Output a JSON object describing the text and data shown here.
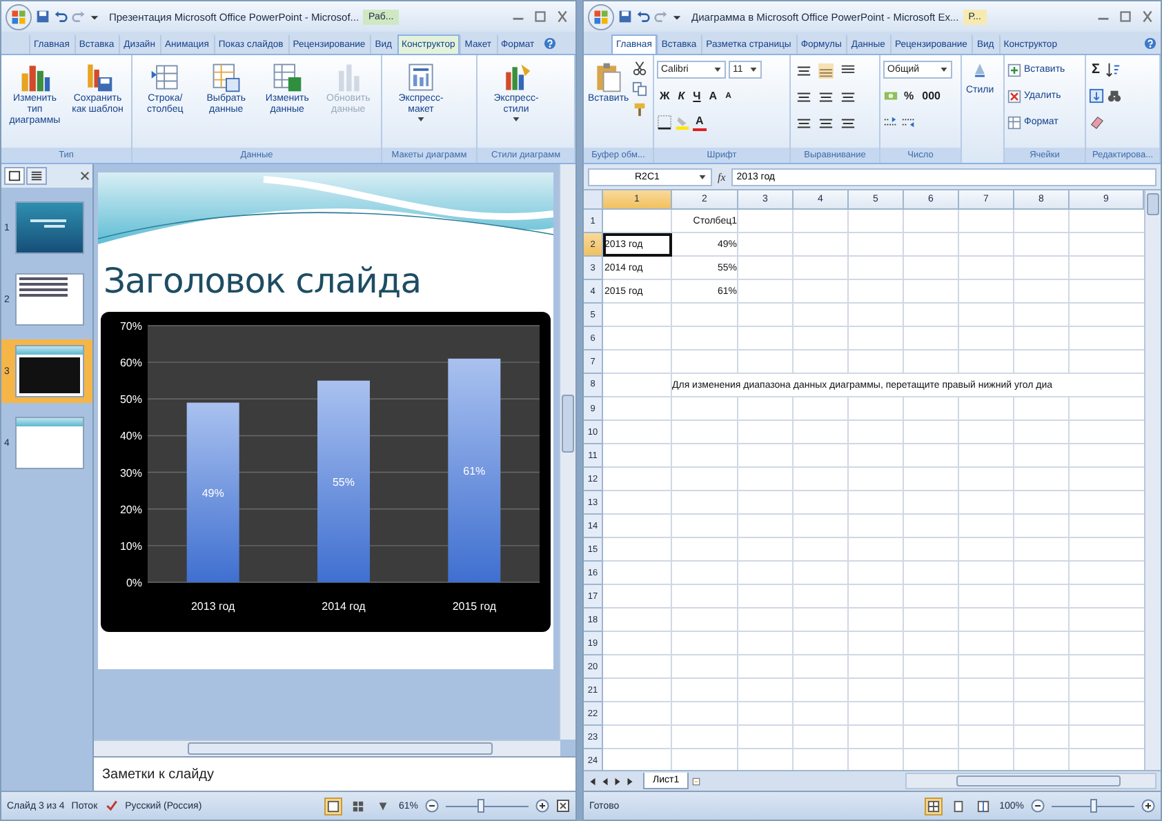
{
  "powerpoint": {
    "title": "Презентация Microsoft Office PowerPoint - Microsof...",
    "context_tab": "Раб...",
    "tabs": [
      {
        "label": "Главная",
        "selected": false
      },
      {
        "label": "Вставка",
        "selected": false
      },
      {
        "label": "Дизайн",
        "selected": false
      },
      {
        "label": "Анимация",
        "selected": false
      },
      {
        "label": "Показ слайдов",
        "selected": false
      },
      {
        "label": "Рецензирование",
        "selected": false
      },
      {
        "label": "Вид",
        "selected": false
      },
      {
        "label": "Конструктор",
        "selected": true
      },
      {
        "label": "Макет",
        "selected": false
      },
      {
        "label": "Формат",
        "selected": false
      }
    ],
    "ribbon": [
      {
        "label": "Тип",
        "buttons": [
          {
            "kind": "chart-type",
            "label": "Изменить тип диаграммы",
            "disabled": false
          },
          {
            "kind": "save-template",
            "label": "Сохранить как шаблон",
            "disabled": false
          }
        ]
      },
      {
        "label": "Данные",
        "buttons": [
          {
            "kind": "switch",
            "label": "Строка/столбец",
            "disabled": false
          },
          {
            "kind": "select-data",
            "label": "Выбрать данные",
            "disabled": false
          },
          {
            "kind": "edit-data",
            "label": "Изменить данные",
            "disabled": false
          },
          {
            "kind": "refresh",
            "label": "Обновить данные",
            "disabled": true
          }
        ]
      },
      {
        "label": "Макеты диаграмм",
        "buttons": [
          {
            "kind": "layout",
            "label": "Экспресс-макет",
            "disabled": false
          }
        ]
      },
      {
        "label": "Стили диаграмм",
        "buttons": [
          {
            "kind": "styles",
            "label": "Экспресс-стили",
            "disabled": false
          }
        ]
      }
    ],
    "pane_tabs": [
      {
        "kind": "slides",
        "selected": true
      },
      {
        "kind": "outline",
        "selected": false
      }
    ],
    "slides": [
      {
        "number": "1",
        "kind": "title",
        "selected": false
      },
      {
        "number": "2",
        "kind": "bullets",
        "selected": false
      },
      {
        "number": "3",
        "kind": "chart",
        "selected": true
      },
      {
        "number": "4",
        "kind": "blank",
        "selected": false
      }
    ],
    "slide": {
      "title": "Заголовок слайда",
      "chart_data": {
        "type": "bar",
        "categories": [
          "2013 год",
          "2014 год",
          "2015 год"
        ],
        "series": [
          {
            "color": "#3f6fd0",
            "values": [
              0.49,
              0.55,
              0.61
            ]
          }
        ],
        "ylim": [
          0,
          0.7
        ],
        "grid": true,
        "yticks": [
          {
            "value": 0,
            "label": "0%"
          },
          {
            "value": 0.1,
            "label": "10%"
          },
          {
            "value": 0.2,
            "label": "20%"
          },
          {
            "value": 0.3,
            "label": "30%"
          },
          {
            "value": 0.4,
            "label": "40%"
          },
          {
            "value": 0.5,
            "label": "50%"
          },
          {
            "value": 0.6,
            "label": "60%"
          },
          {
            "value": 0.7,
            "label": "70%"
          }
        ],
        "value_labels": [
          "49%",
          "55%",
          "61%"
        ]
      }
    },
    "notes": {
      "text": "Заметки к слайду"
    },
    "status": {
      "slide": "Слайд 3 из 4",
      "theme": "Поток",
      "language": "Русский (Россия)",
      "views": [
        {
          "kind": "normal",
          "selected": true
        },
        {
          "kind": "sorter",
          "selected": false
        },
        {
          "kind": "show",
          "selected": false
        }
      ],
      "zoom": "61%",
      "zoom_slider": {
        "level": 0.42
      }
    }
  },
  "excel": {
    "title": "Диаграмма в Microsoft Office PowerPoint - Microsoft Ex...",
    "context_tab": "Р...",
    "tabs": [
      {
        "label": "Главная",
        "selected": true
      },
      {
        "label": "Вставка",
        "selected": false
      },
      {
        "label": "Разметка страницы",
        "selected": false
      },
      {
        "label": "Формулы",
        "selected": false
      },
      {
        "label": "Данные",
        "selected": false
      },
      {
        "label": "Рецензирование",
        "selected": false
      },
      {
        "label": "Вид",
        "selected": false
      },
      {
        "label": "Конструктор",
        "selected": false
      }
    ],
    "ribbon": {
      "clipboard": {
        "label": "Буфер обм...",
        "paste": "Вставить"
      },
      "font": {
        "label": "Шрифт",
        "name": "Calibri",
        "size": "11",
        "buttons": [
          {
            "kind": "bold",
            "label": "Ж"
          },
          {
            "kind": "italic",
            "label": "К"
          },
          {
            "kind": "underline",
            "label": "Ч"
          },
          {
            "kind": "grow",
            "label": "A"
          },
          {
            "kind": "shrink",
            "label": "A"
          }
        ],
        "color_button": "A"
      },
      "alignment": {
        "label": "Выравнивание"
      },
      "number": {
        "label": "Число",
        "format": "Общий",
        "percent": "%",
        "thousands": "000"
      },
      "styles": {
        "label": "Стили"
      },
      "cells": {
        "label": "Ячейки",
        "buttons": [
          {
            "kind": "insert",
            "label": "Вставить"
          },
          {
            "kind": "delete",
            "label": "Удалить"
          },
          {
            "kind": "format",
            "label": "Формат"
          }
        ]
      },
      "editing": {
        "label": "Редактирова...",
        "sum": "Σ"
      }
    },
    "name_box": "R2C1",
    "function_label": "fx",
    "formula": "2013 год",
    "columns": [
      {
        "label": "1",
        "selected": true
      },
      {
        "label": "2",
        "selected": false
      },
      {
        "label": "3",
        "selected": false
      },
      {
        "label": "4",
        "selected": false
      },
      {
        "label": "5",
        "selected": false
      },
      {
        "label": "6",
        "selected": false
      },
      {
        "label": "7",
        "selected": false
      },
      {
        "label": "8",
        "selected": false
      },
      {
        "label": "9",
        "selected": false
      }
    ],
    "rows": [
      {
        "header": "1",
        "selected": false,
        "column_2": "Столбец1"
      },
      {
        "header": "2",
        "selected": true,
        "column_1": "2013 год",
        "column_2": "49%"
      },
      {
        "header": "3",
        "selected": false,
        "column_1": "2014 год",
        "column_2": "55%"
      },
      {
        "header": "4",
        "selected": false,
        "column_1": "2015 год",
        "column_2": "61%"
      },
      {
        "header": "5",
        "selected": false
      },
      {
        "header": "6",
        "selected": false
      },
      {
        "header": "7",
        "selected": false
      },
      {
        "header": "8",
        "selected": false,
        "overflow": "Для изменения диапазона данных диаграммы, перетащите правый нижний угол диа"
      },
      {
        "header": "9",
        "selected": false
      },
      {
        "header": "10",
        "selected": false
      },
      {
        "header": "11",
        "selected": false
      },
      {
        "header": "12",
        "selected": false
      },
      {
        "header": "13",
        "selected": false
      },
      {
        "header": "14",
        "selected": false
      },
      {
        "header": "15",
        "selected": false
      },
      {
        "header": "16",
        "selected": false
      },
      {
        "header": "17",
        "selected": false
      },
      {
        "header": "18",
        "selected": false
      },
      {
        "header": "19",
        "selected": false
      },
      {
        "header": "20",
        "selected": false
      },
      {
        "header": "21",
        "selected": false
      },
      {
        "header": "22",
        "selected": false
      },
      {
        "header": "23",
        "selected": false
      },
      {
        "header": "24",
        "selected": false
      }
    ],
    "sheet_tabs": [
      {
        "label": "Лист1",
        "selected": true
      }
    ],
    "status": {
      "text": "Готово",
      "views": [
        {
          "kind": "normal",
          "selected": true
        },
        {
          "kind": "layout",
          "selected": false
        },
        {
          "kind": "break",
          "selected": false
        }
      ],
      "zoom": "100%",
      "zoom_slider": {
        "level": 0.5
      }
    }
  }
}
